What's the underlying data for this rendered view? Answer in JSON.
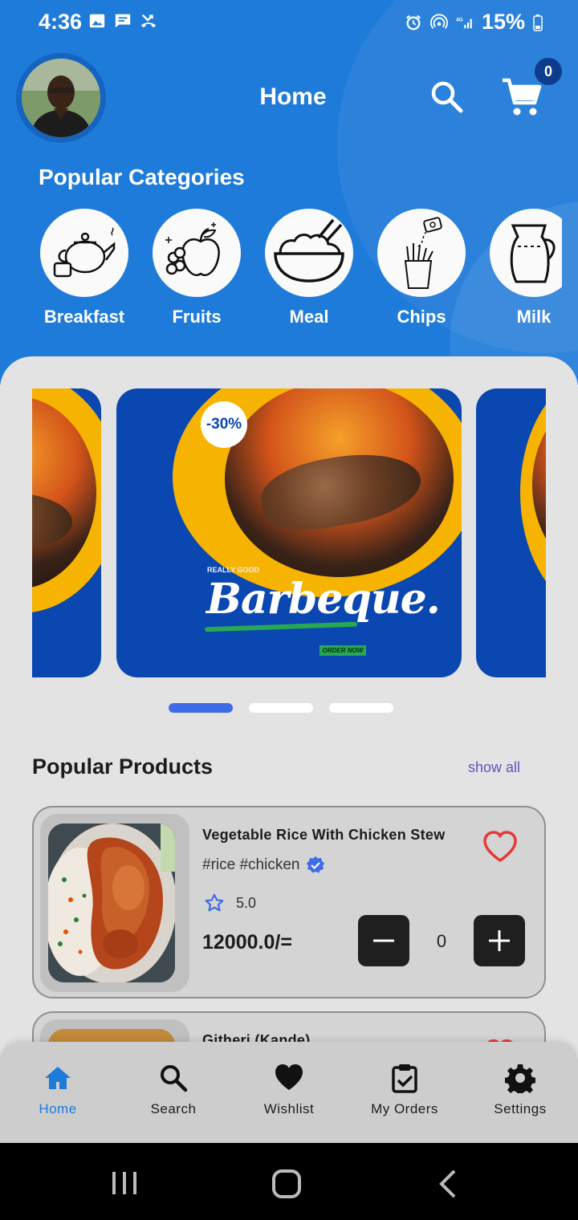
{
  "status_bar": {
    "time": "4:36",
    "battery": "15%"
  },
  "header": {
    "title": "Home",
    "cart_count": "0"
  },
  "categories_section": {
    "title": "Popular Categories",
    "items": [
      {
        "label": "Breakfast",
        "icon": "teapot-icon"
      },
      {
        "label": "Fruits",
        "icon": "fruits-icon"
      },
      {
        "label": "Meal",
        "icon": "rice-bowl-icon"
      },
      {
        "label": "Chips",
        "icon": "fries-icon"
      },
      {
        "label": "Milk",
        "icon": "milk-jug-icon"
      }
    ]
  },
  "carousel": {
    "active_index": 0,
    "slide_count": 3,
    "banner": {
      "discount": "-30%",
      "kicker": "REALLY GOOD",
      "title": "Barbeque.",
      "cta": "ORDER NOW"
    }
  },
  "products_section": {
    "title": "Popular Products",
    "show_all": "show all",
    "items": [
      {
        "name": "Vegetable Rice With Chicken Stew",
        "tags": "#rice #chicken",
        "rating": "5.0",
        "price": "12000.0/=",
        "quantity": "0",
        "favorite": true
      },
      {
        "name": "Githeri (Kande)",
        "favorite": true
      }
    ]
  },
  "bottom_nav": [
    {
      "label": "Home",
      "icon": "home-icon",
      "active": true
    },
    {
      "label": "Search",
      "icon": "search-icon",
      "active": false
    },
    {
      "label": "Wishlist",
      "icon": "heart-icon",
      "active": false
    },
    {
      "label": "My Orders",
      "icon": "clipboard-check-icon",
      "active": false
    },
    {
      "label": "Settings",
      "icon": "gear-icon",
      "active": false
    }
  ],
  "colors": {
    "header_blue": "#1f7bd9",
    "accent_blue": "#3e6be6",
    "banner_blue": "#0a47b0",
    "banner_yellow": "#f6b301",
    "heart_red": "#e53935"
  }
}
